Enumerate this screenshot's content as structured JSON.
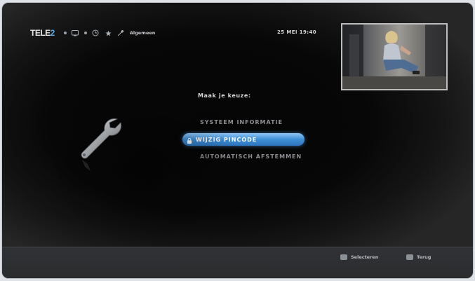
{
  "topbar": {
    "logo_part1": "TELE",
    "logo_part2": "2",
    "section_label": "Algemeen",
    "icons": [
      "tv-icon",
      "clock-icon",
      "star-icon",
      "wrench-icon"
    ]
  },
  "clock": "25 MEI 19:40",
  "preview": {
    "icon": "live-tv-preview-image"
  },
  "menu": {
    "title": "Maak je keuze:",
    "items": [
      {
        "label": "SYSTEEM INFORMATIE",
        "selected": false
      },
      {
        "label": "WIJZIG PINCODE",
        "selected": true,
        "icon": "lock-icon"
      },
      {
        "label": "AUTOMATISCH AFSTEMMEN",
        "selected": false
      }
    ]
  },
  "bottombar": {
    "hints": [
      {
        "key_icon": "ok-key-icon",
        "label": "Selecteren"
      },
      {
        "key_icon": "back-key-icon",
        "label": "Terug"
      }
    ]
  },
  "colors": {
    "accent": "#3f8fd6",
    "background": "#070707",
    "menu_text": "#8d8f92"
  }
}
